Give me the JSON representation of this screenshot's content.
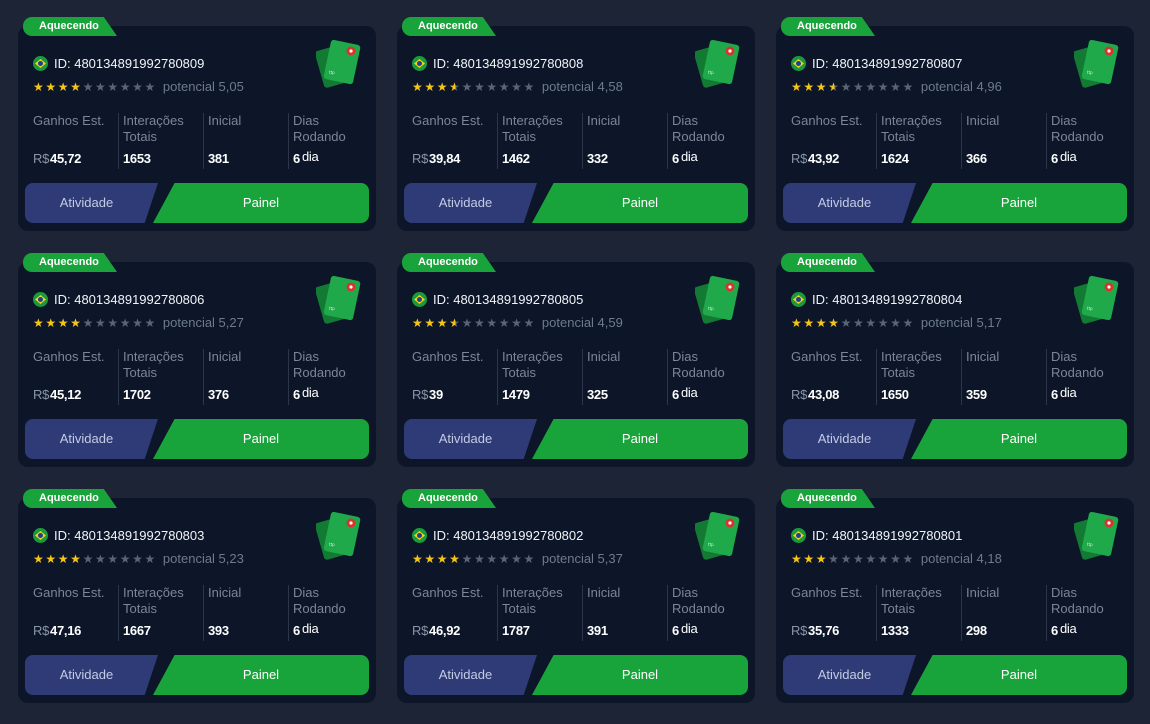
{
  "cards": [
    {
      "tag": "Aquecendo",
      "id": "ID: 480134891992780809",
      "potential": "potencial 5,05",
      "rating": 4,
      "stats": {
        "earnings_label": "Ganhos Est.",
        "earnings_currency": "R$",
        "earnings_value": "45,72",
        "interactions_label": "Interações Totais",
        "interactions_value": "1653",
        "initial_label": "Inicial",
        "initial_value": "381",
        "days_label": "Dias Rodando",
        "days_value": "6",
        "days_unit": "dia"
      },
      "activity_label": "Atividade",
      "panel_label": "Painel"
    },
    {
      "tag": "Aquecendo",
      "id": "ID: 480134891992780808",
      "potential": "potencial 4,58",
      "rating": 3.5,
      "stats": {
        "earnings_label": "Ganhos Est.",
        "earnings_currency": "R$",
        "earnings_value": "39,84",
        "interactions_label": "Interações Totais",
        "interactions_value": "1462",
        "initial_label": "Inicial",
        "initial_value": "332",
        "days_label": "Dias Rodando",
        "days_value": "6",
        "days_unit": "dia"
      },
      "activity_label": "Atividade",
      "panel_label": "Painel"
    },
    {
      "tag": "Aquecendo",
      "id": "ID: 480134891992780807",
      "potential": "potencial 4,96",
      "rating": 3.5,
      "stats": {
        "earnings_label": "Ganhos Est.",
        "earnings_currency": "R$",
        "earnings_value": "43,92",
        "interactions_label": "Interações Totais",
        "interactions_value": "1624",
        "initial_label": "Inicial",
        "initial_value": "366",
        "days_label": "Dias Rodando",
        "days_value": "6",
        "days_unit": "dia"
      },
      "activity_label": "Atividade",
      "panel_label": "Painel"
    },
    {
      "tag": "Aquecendo",
      "id": "ID: 480134891992780806",
      "potential": "potencial 5,27",
      "rating": 4,
      "stats": {
        "earnings_label": "Ganhos Est.",
        "earnings_currency": "R$",
        "earnings_value": "45,12",
        "interactions_label": "Interações Totais",
        "interactions_value": "1702",
        "initial_label": "Inicial",
        "initial_value": "376",
        "days_label": "Dias Rodando",
        "days_value": "6",
        "days_unit": "dia"
      },
      "activity_label": "Atividade",
      "panel_label": "Painel"
    },
    {
      "tag": "Aquecendo",
      "id": "ID: 480134891992780805",
      "potential": "potencial 4,59",
      "rating": 3.5,
      "stats": {
        "earnings_label": "Ganhos Est.",
        "earnings_currency": "R$",
        "earnings_value": "39",
        "interactions_label": "Interações Totais",
        "interactions_value": "1479",
        "initial_label": "Inicial",
        "initial_value": "325",
        "days_label": "Dias Rodando",
        "days_value": "6",
        "days_unit": "dia"
      },
      "activity_label": "Atividade",
      "panel_label": "Painel"
    },
    {
      "tag": "Aquecendo",
      "id": "ID: 480134891992780804",
      "potential": "potencial 5,17",
      "rating": 4,
      "stats": {
        "earnings_label": "Ganhos Est.",
        "earnings_currency": "R$",
        "earnings_value": "43,08",
        "interactions_label": "Interações Totais",
        "interactions_value": "1650",
        "initial_label": "Inicial",
        "initial_value": "359",
        "days_label": "Dias Rodando",
        "days_value": "6",
        "days_unit": "dia"
      },
      "activity_label": "Atividade",
      "panel_label": "Painel"
    },
    {
      "tag": "Aquecendo",
      "id": "ID: 480134891992780803",
      "potential": "potencial 5,23",
      "rating": 4,
      "stats": {
        "earnings_label": "Ganhos Est.",
        "earnings_currency": "R$",
        "earnings_value": "47,16",
        "interactions_label": "Interações Totais",
        "interactions_value": "1667",
        "initial_label": "Inicial",
        "initial_value": "393",
        "days_label": "Dias Rodando",
        "days_value": "6",
        "days_unit": "dia"
      },
      "activity_label": "Atividade",
      "panel_label": "Painel"
    },
    {
      "tag": "Aquecendo",
      "id": "ID: 480134891992780802",
      "potential": "potencial 5,37",
      "rating": 4,
      "stats": {
        "earnings_label": "Ganhos Est.",
        "earnings_currency": "R$",
        "earnings_value": "46,92",
        "interactions_label": "Interações Totais",
        "interactions_value": "1787",
        "initial_label": "Inicial",
        "initial_value": "391",
        "days_label": "Dias Rodando",
        "days_value": "6",
        "days_unit": "dia"
      },
      "activity_label": "Atividade",
      "panel_label": "Painel"
    },
    {
      "tag": "Aquecendo",
      "id": "ID: 480134891992780801",
      "potential": "potencial 4,18",
      "rating": 3,
      "stats": {
        "earnings_label": "Ganhos Est.",
        "earnings_currency": "R$",
        "earnings_value": "35,76",
        "interactions_label": "Interações Totais",
        "interactions_value": "1333",
        "initial_label": "Inicial",
        "initial_value": "298",
        "days_label": "Dias Rodando",
        "days_value": "6",
        "days_unit": "dia"
      },
      "activity_label": "Atividade",
      "panel_label": "Painel"
    }
  ],
  "colors": {
    "background": "#1c2435",
    "card": "#0c1628",
    "accent_green": "#18a43a",
    "activity_button": "#2e3b77",
    "star": "#f5c518"
  },
  "icons": {
    "flag": "brazil-flag-icon",
    "cards": "sim-cards-icon",
    "star": "star-icon"
  }
}
